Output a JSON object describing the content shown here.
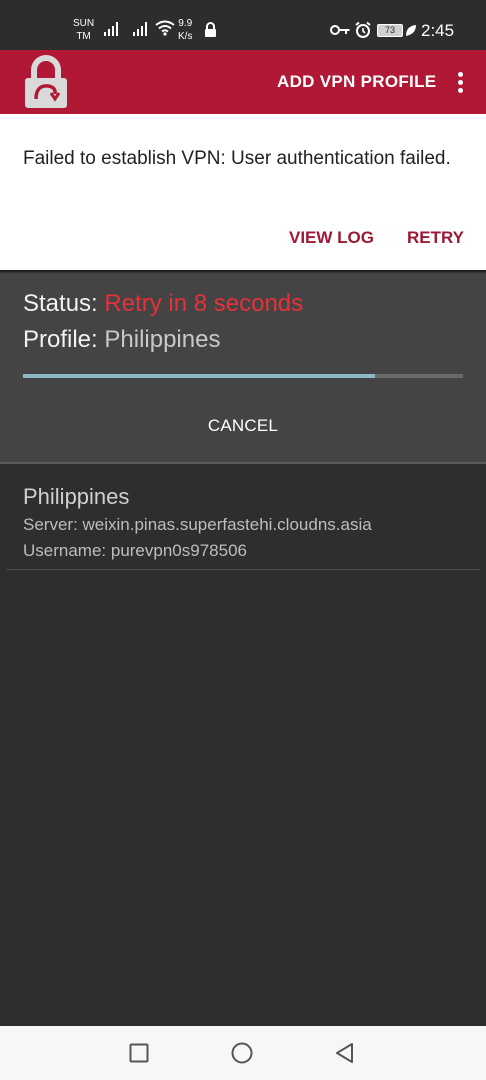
{
  "status_bar": {
    "carrier_line1": "SUN",
    "carrier_line2": "TM",
    "speed_value": "9.9",
    "speed_unit": "K/s",
    "battery": "73",
    "time": "2:45",
    "icons": [
      "signal-icon",
      "signal-icon",
      "wifi-icon",
      "lock-icon",
      "vpn-key-icon",
      "alarm-icon",
      "battery-icon",
      "leaf-icon"
    ]
  },
  "app_bar": {
    "logo": "padlock-logo",
    "add_profile_label": "ADD VPN PROFILE",
    "menu_icon": "more-vert-icon"
  },
  "banner": {
    "message": "Failed to establish VPN: User authentication failed.",
    "view_log_label": "VIEW LOG",
    "retry_label": "RETRY"
  },
  "status_panel": {
    "status_label": "Status:",
    "status_value": "Retry in 8 seconds",
    "profile_label": "Profile:",
    "profile_value": "Philippines",
    "progress": 0.8,
    "cancel_label": "CANCEL"
  },
  "profiles": [
    {
      "name": "Philippines",
      "server": "Server: weixin.pinas.superfastehi.cloudns.asia",
      "username": "Username: purevpn0s978506"
    }
  ],
  "nav_bar": {
    "icons": [
      "recents-square-icon",
      "home-circle-icon",
      "back-triangle-icon"
    ]
  },
  "colors": {
    "accent": "#b11835",
    "action_text": "#9c1a36",
    "status_red": "#e5323a",
    "progress": "#8fb8c6"
  }
}
